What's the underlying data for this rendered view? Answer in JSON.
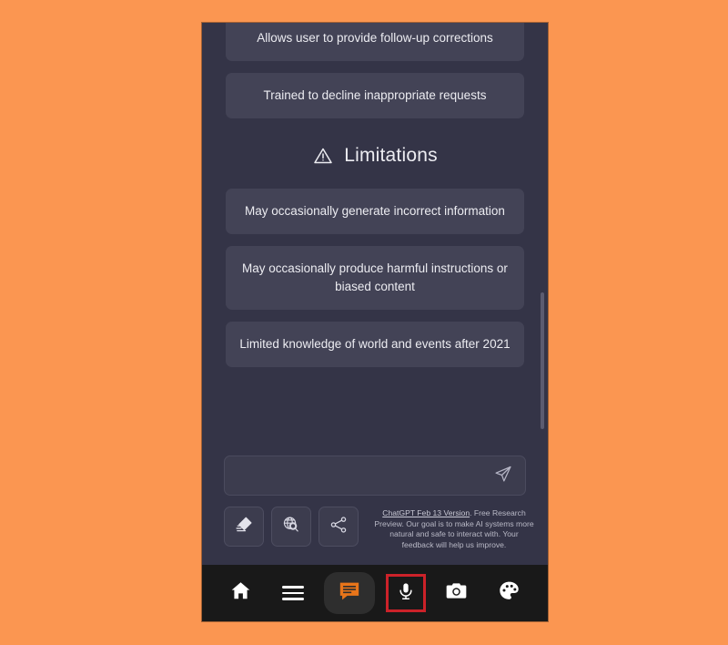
{
  "theme": {
    "page_background": "#fb9651",
    "app_background": "#343447",
    "card_background": "#434356",
    "nav_background": "#191919",
    "accent_orange": "#e8751a",
    "highlight_red": "#cc2229",
    "text_primary": "#ececf1"
  },
  "content": {
    "capabilities_cards": [
      {
        "text": "Allows user to provide follow-up corrections"
      },
      {
        "text": "Trained to decline inappropriate requests"
      }
    ],
    "limitations_heading": "Limitations",
    "limitations_icon": "warning-triangle-icon",
    "limitations_cards": [
      {
        "text": "May occasionally generate incorrect information"
      },
      {
        "text": "May occasionally produce harmful instructions or biased content"
      },
      {
        "text": "Limited knowledge of world and events after 2021"
      }
    ]
  },
  "composer": {
    "value": "",
    "placeholder": "",
    "send_icon": "send-paper-plane-icon"
  },
  "tools": [
    {
      "name": "eraser-icon",
      "label": "Clear conversation"
    },
    {
      "name": "globe-search-icon",
      "label": "Web search"
    },
    {
      "name": "share-icon",
      "label": "Share"
    }
  ],
  "disclaimer": {
    "version_link": "ChatGPT Feb 13 Version",
    "body": ". Free Research Preview. Our goal is to make AI systems more natural and safe to interact with. Your feedback will help us improve."
  },
  "bottom_nav": [
    {
      "name": "home-icon",
      "label": "Home",
      "active": false
    },
    {
      "name": "menu-icon",
      "label": "Menu",
      "active": false
    },
    {
      "name": "chat-icon",
      "label": "Chat",
      "active": true
    },
    {
      "name": "microphone-icon",
      "label": "Voice",
      "active": false,
      "highlighted": true
    },
    {
      "name": "camera-icon",
      "label": "Camera",
      "active": false
    },
    {
      "name": "palette-icon",
      "label": "Themes",
      "active": false
    }
  ],
  "scrollbar": {
    "visible": true
  }
}
